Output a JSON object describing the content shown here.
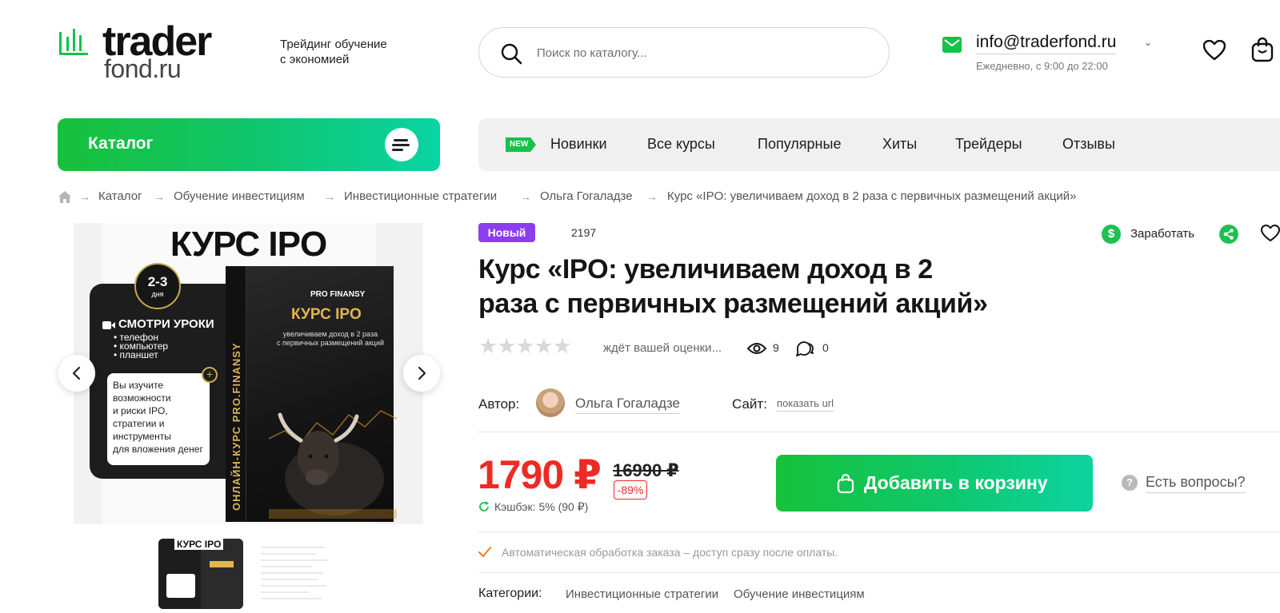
{
  "brand": {
    "word1": "trader",
    "word2": "fond.ru",
    "tagline": "Трейдинг обучение\nс экономией",
    "accent": "#16c24a"
  },
  "search": {
    "placeholder": "Поиск по каталогу..."
  },
  "contact": {
    "email": "info@traderfond.ru",
    "hours": "Ежедневно, с 9:00 до 22:00"
  },
  "catalog": {
    "label": "Каталог"
  },
  "nav": {
    "new_tag": "NEW",
    "items": [
      "Новинки",
      "Все курсы",
      "Популярные",
      "Хиты",
      "Трейдеры",
      "Отзывы"
    ]
  },
  "breadcrumb": [
    "Каталог",
    "Обучение инвестициям",
    "Инвестиционные стратегии",
    "Ольга Гогаладзе",
    "Курс «IPO: увеличиваем доход в 2 раза с первичных размещений акций»"
  ],
  "gallery": {
    "cover_title": "КУРС IPO",
    "days": "2-3",
    "days_sub": "дня",
    "watch_title": "СМОТРИ УРОКИ",
    "watch_items": [
      "телефон",
      "компьютер",
      "планшет"
    ],
    "card_text": "Вы изучите\nвозможности\nи риски IPO,\nстратегии и\nинструменты\nдля вложения денег",
    "box_brand": "PRO FINANSY",
    "box_course": "КУРС IPO",
    "box_desc": "увеличиваем доход в 2 раза\nс первичных размещений акций",
    "box_side": "ОНЛАЙН-КУРС PRO.FINANSY",
    "thumb_title": "КУРС IPO"
  },
  "product": {
    "badge": "Новый",
    "sku": "2197",
    "earn": "Заработать",
    "title": "Курс «IPO: увеличиваем доход в 2\nраза с первичных размещений акций»",
    "stars": "★★★★★",
    "rating_text": "ждёт вашей оценки...",
    "views": "9",
    "comments": "0",
    "author_label": "Автор:",
    "author_name": "Ольга Гогаладзе",
    "site_label": "Сайт:",
    "site_link": "показать url",
    "price": "1790 ₽",
    "old_price": "16990 ₽",
    "discount": "-89%",
    "cashback": "Кэшбэк: 5% (90 ₽)",
    "add_to_cart": "Добавить в корзину",
    "questions": "Есть вопросы?",
    "auto_processing": "Автоматическая обработка заказа – доступ сразу после оплаты.",
    "categories_label": "Категории:",
    "categories": [
      "Инвестиционные стратегии",
      "Обучение инвестициям"
    ],
    "price_color": "#ee2a24",
    "badge_color": "#8b3df0"
  }
}
